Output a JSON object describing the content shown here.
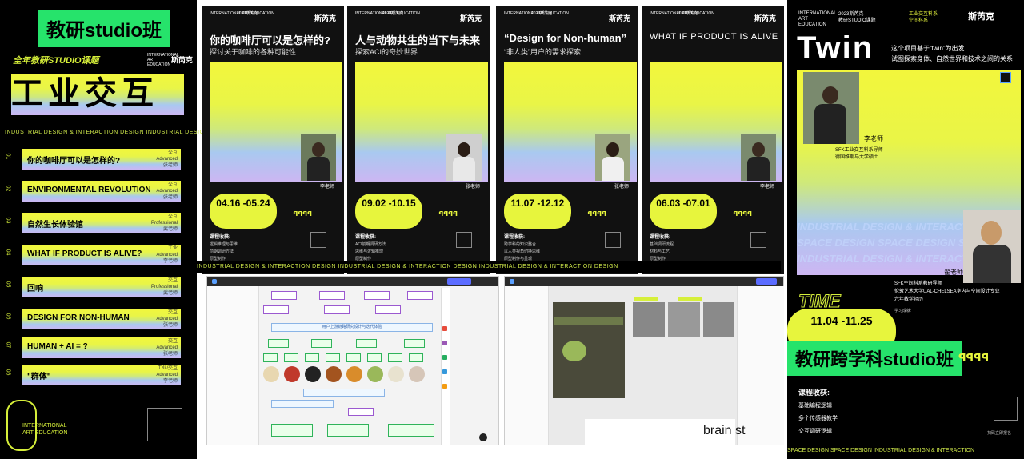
{
  "left": {
    "tag": "教研studio班",
    "year_label": "全年教研STUDIO课题",
    "org": "INTERNATIONAL ART EDUCATION",
    "logo": "斯芮克",
    "big_title": "工业交互",
    "stripe": "INDUSTRIAL DESIGN & INTERACTION DESIGN  INDUSTRIAL DESIGN & INTERACTION DESIGN",
    "courses": [
      {
        "num": "01",
        "title": "你的咖啡厅可以是怎样的?",
        "meta1": "交互",
        "meta2": "Advanced",
        "meta3": "张老师"
      },
      {
        "num": "02",
        "title": "ENVIRONMENTAL REVOLUTION",
        "meta1": "交互",
        "meta2": "Advanced",
        "meta3": "张老师"
      },
      {
        "num": "03",
        "title": "自然生长体验馆",
        "meta1": "交互",
        "meta2": "Professional",
        "meta3": "武老师"
      },
      {
        "num": "04",
        "title": "WHAT IF PRODUCT IS ALIVE?",
        "meta1": "工业",
        "meta2": "Advanced",
        "meta3": "李老师"
      },
      {
        "num": "05",
        "title": "回响",
        "meta1": "交互",
        "meta2": "Professional",
        "meta3": "武老师"
      },
      {
        "num": "06",
        "title": "DESIGN FOR NON-HUMAN",
        "meta1": "交互",
        "meta2": "Advanced",
        "meta3": "张老师"
      },
      {
        "num": "07",
        "title": "HUMAN + AI = ?",
        "meta1": "交互",
        "meta2": "Advanced",
        "meta3": "张老师"
      },
      {
        "num": "08",
        "title": "\"群体\"",
        "meta1": "工业/交互",
        "meta2": "Advanced",
        "meta3": "李老师"
      }
    ],
    "footer_logo": "INTERNATIONAL ART EDUCATION"
  },
  "posters": [
    {
      "title": "你的咖啡厅可以是怎样的?",
      "sub": "探讨关于咖啡的各种可能性",
      "teacher": "李老师",
      "dates": "04.16 -05.24",
      "gain": "课程收获:",
      "g1": "逻辑推理与思维",
      "g2": "前期调研方法",
      "g3": "原型制作"
    },
    {
      "title": "人与动物共生的当下与未来",
      "sub": "探索ACI的奇妙世界",
      "teacher": "张老师",
      "dates": "09.02 -10.15",
      "gain": "课程收获:",
      "g1": "ACI前期调研方法",
      "g2": "思维与逻辑推理",
      "g3": "原型制作"
    },
    {
      "title": "“Design for Non-human”",
      "sub": "“非人类”用户的需求探索",
      "teacher": "张老师",
      "dates": "11.07 -12.12",
      "gain": "课程收获:",
      "g1": "跨学科的知识整合",
      "g2": "以人类视角切换思维",
      "g3": "原型制作与呈现"
    },
    {
      "title": "WHAT IF PRODUCT IS ALIVE",
      "sub": "",
      "teacher": "李老师",
      "dates": "06.03 -07.01",
      "gain": "课程收获:",
      "g1": "基础调研流程",
      "g2": "材料与工艺",
      "g3": "原型制作"
    }
  ],
  "poster_common": {
    "org": "INTERNATIONAL ART EDUCATION",
    "year": "2023斯芮克",
    "logo": "斯芮克",
    "deco": "ꟼꟼꟼꟼ",
    "scan": "扫码立即报名"
  },
  "mid_stripe": "INDUSTRIAL DESIGN & INTERACTION DESIGN  INDUSTRIAL DESIGN & INTERACTION DESIGN  INDUSTRIAL DESIGN & INTERACTION DESIGN",
  "shot1": {
    "banner": "用户上游链路研究设计与迭代体验"
  },
  "shot2": {
    "text": "brain st"
  },
  "right": {
    "org": "INTERNATIONAL ART EDUCATION",
    "year": "2023斯芮克",
    "year2": "教研STUDIO课题",
    "cat1": "工业交互科系",
    "cat2": "空间科系",
    "logo": "斯芮克",
    "title": "Twin",
    "intro1": "这个项目基于“twin”为出发",
    "intro2": "试图探索身体、自然世界和技术之间的关系",
    "name1": "李老师",
    "t1a": "SFK工业交互科系导师",
    "t1b": "德国维斯马大学硕士",
    "stripe1": "INDUSTRIAL DESIGN & INTERACTION",
    "stripe2": "SPACE DESIGN SPACE DESIGN S",
    "stripe3": "INDUSTRIAL DESIGN & INTERACTION",
    "name2": "翟老师",
    "t2a": "SFK空间科系教研导师",
    "t2b": "伦敦艺术大学UAL-CHELSEA室内与空间设计专业",
    "t2c": "六年教学经历",
    "bio": "学习成就:",
    "time": "TIME",
    "dates": "11.04 -11.25",
    "tag": "教研跨学科studio班",
    "gain": "课程收获:",
    "g1": "基础编程逻辑",
    "g2": "多个传感器教学",
    "g3": "交互调研逻辑",
    "scan": "扫码立即报名",
    "stripe_b": "SPACE DESIGN  SPACE DESIGN  INDUSTRIAL DESIGN & INTERACTION"
  },
  "colors": {
    "accent": "#e7f53d",
    "tag_green": "#26e36b",
    "dark": "#111111"
  }
}
